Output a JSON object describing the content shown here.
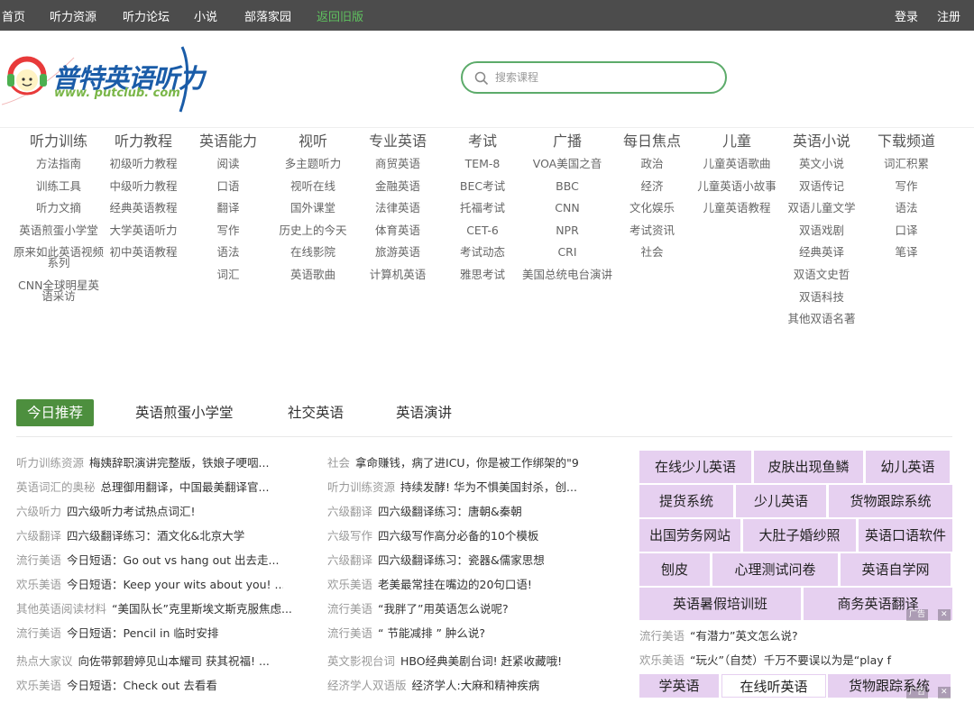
{
  "top_nav": {
    "links": [
      {
        "label": "首页"
      },
      {
        "label": "听力资源"
      },
      {
        "label": "听力论坛"
      },
      {
        "label": "小说"
      },
      {
        "label": "部落家园"
      },
      {
        "label": "返回旧版"
      }
    ],
    "login": "登录",
    "register": "注册",
    "colors": {
      "bg": "#4c4c4c",
      "text": "#ffffff",
      "highlight": "#5fc25f"
    }
  },
  "logo": {
    "text": "普特英语听力",
    "url_text": "www. putclub. com"
  },
  "search": {
    "placeholder": "搜索课程",
    "value": ""
  },
  "nav_columns": [
    {
      "heading": "听力训练",
      "items": [
        "方法指南",
        "训练工具",
        "听力文摘",
        "英语煎蛋小学堂",
        "原来如此英语视频系列",
        "CNN全球明星英语采访"
      ]
    },
    {
      "heading": "听力教程",
      "items": [
        "初级听力教程",
        "中级听力教程",
        "经典英语教程",
        "大学英语听力",
        "初中英语教程"
      ]
    },
    {
      "heading": "英语能力",
      "items": [
        "阅读",
        "口语",
        "翻译",
        "写作",
        "语法",
        "词汇"
      ]
    },
    {
      "heading": "视听",
      "items": [
        "多主题听力",
        "视听在线",
        "国外课堂",
        "历史上的今天",
        "在线影院",
        "英语歌曲"
      ]
    },
    {
      "heading": "专业英语",
      "items": [
        "商贸英语",
        "金融英语",
        "法律英语",
        "体育英语",
        "旅游英语",
        "计算机英语"
      ]
    },
    {
      "heading": "考试",
      "items": [
        "TEM-8",
        "BEC考试",
        "托福考试",
        "CET-6",
        "考试动态",
        "雅思考试"
      ]
    },
    {
      "heading": "广播",
      "items": [
        "VOA美国之音",
        "BBC",
        "CNN",
        "NPR",
        "CRI",
        "美国总统电台演讲"
      ]
    },
    {
      "heading": "每日焦点",
      "items": [
        "政治",
        "经济",
        "文化娱乐",
        "考试资讯",
        "社会"
      ]
    },
    {
      "heading": "儿童",
      "items": [
        "儿童英语歌曲",
        "儿童英语小故事",
        "儿童英语教程"
      ]
    },
    {
      "heading": "英语小说",
      "items": [
        "英文小说",
        "双语传记",
        "双语儿童文学",
        "双语戏剧",
        "经典英译",
        "双语文史哲",
        "双语科技",
        "其他双语名著"
      ]
    },
    {
      "heading": "下载频道",
      "items": [
        "词汇积累",
        "写作",
        "语法",
        "口译",
        "笔译"
      ]
    }
  ],
  "tabs": [
    {
      "label": "今日推荐",
      "active": true
    },
    {
      "label": "英语煎蛋小学堂"
    },
    {
      "label": "社交英语"
    },
    {
      "label": "英语演讲"
    }
  ],
  "news_left": [
    {
      "cat": "听力训练资源",
      "title": "梅姨辞职演讲完整版，铁娘子哽咽..."
    },
    {
      "cat": "英语词汇的奥秘",
      "title": "总理御用翻译，中国最美翻译官..."
    },
    {
      "cat": "六级听力",
      "title": "四六级听力考试热点词汇!"
    },
    {
      "cat": "六级翻译",
      "title": "四六级翻译练习：酒文化&北京大学"
    },
    {
      "cat": "流行美语",
      "title": "今日短语：Go out vs hang out 出去走..."
    },
    {
      "cat": "欢乐美语",
      "title": "今日短语：Keep your wits about you! ..."
    },
    {
      "cat": "其他英语阅读材料",
      "title": "“美国队长”克里斯埃文斯克服焦虑..."
    },
    {
      "cat": "流行美语",
      "title": "今日短语：Pencil in 临时安排"
    },
    {
      "cat": "热点大家议",
      "title": "向佐带郭碧婷见山本耀司 获其祝福! ..."
    },
    {
      "cat": "欢乐美语",
      "title": "今日短语：Check out 去看看"
    }
  ],
  "news_right": [
    {
      "cat": "社会",
      "title": "拿命赚钱，病了进ICU，你是被工作绑架的\"9"
    },
    {
      "cat": "听力训练资源",
      "title": "持续发酵! 华为不惧美国封杀，创..."
    },
    {
      "cat": "六级翻译",
      "title": "四六级翻译练习：唐朝&秦朝"
    },
    {
      "cat": "六级写作",
      "title": "四六级写作高分必备的10个模板"
    },
    {
      "cat": "六级翻译",
      "title": "四六级翻译练习：瓷器&儒家思想"
    },
    {
      "cat": "欢乐美语",
      "title": "老美最常挂在嘴边的20句口语!"
    },
    {
      "cat": "流行美语",
      "title": "“我胖了”用英语怎么说呢?"
    },
    {
      "cat": "流行美语",
      "title": "“ 节能减排 ” 肿么说?"
    },
    {
      "cat": "英文影视台词",
      "title": "HBO经典美剧台词! 赶紧收藏哦!"
    },
    {
      "cat": "经济学人双语版",
      "title": "经济学人:大麻和精神疾病"
    }
  ],
  "ad_grid": [
    [
      "在线少儿英语",
      "皮肤出现鱼鳞",
      "幼儿英语"
    ],
    [
      "提货系统",
      "少儿英语",
      "货物跟踪系统"
    ],
    [
      "出国劳务网站",
      "大肚子婚纱照",
      "英语口语软件"
    ],
    [
      "刨皮",
      "心理测试问卷",
      "英语自学网"
    ],
    [
      "英语暑假培训班",
      "商务英语翻译"
    ]
  ],
  "ad_badge": "广告",
  "side_news": [
    {
      "cat": "流行美语",
      "title": "“有潜力”英文怎么说?"
    },
    {
      "cat": "欢乐美语",
      "title": "“玩火”（自焚）千万不要误以为是“play f"
    }
  ],
  "bottom_ads": [
    "学英语",
    "在线听英语",
    "货物跟踪系统"
  ],
  "colors": {
    "accent_green": "#4d8f3e",
    "ad_purple": "#e6d0f0",
    "search_border": "#5cab6a"
  }
}
